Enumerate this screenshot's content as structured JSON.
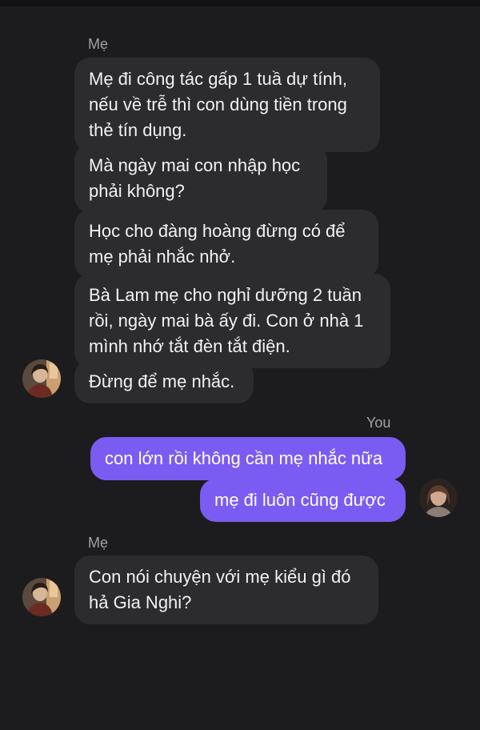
{
  "conversation": {
    "groups": [
      {
        "sender": "Mẹ",
        "messages": [
          "Mẹ đi công tác gấp 1 tuầ dự tính,\nnếu về trễ thì con dùng tiền trong\nthẻ tín dụng.",
          "Mà ngày mai con nhập học\nphải không?",
          "Học cho đàng hoàng đừng có để\nmẹ phải nhắc nhở.",
          "Bà Lam mẹ cho nghỉ dưỡng 2 tuần\nrồi, ngày mai bà ấy đi. Con ở nhà 1\nmình nhớ tắt đèn tắt điện.",
          "Đừng để mẹ nhắc."
        ],
        "avatar_icon": "mother-avatar-icon"
      },
      {
        "sender": "You",
        "messages": [
          "con lớn rồi không cần mẹ nhắc nữa",
          "mẹ đi luôn cũng được"
        ],
        "avatar_icon": "user-avatar-icon"
      },
      {
        "sender": "Mẹ",
        "messages": [
          "Con nói chuyện với mẹ kiểu gì đó\nhả Gia Nghi?"
        ],
        "avatar_icon": "mother-avatar-icon"
      }
    ]
  },
  "colors": {
    "background": "#1c1c1e",
    "incoming_bubble": "#2c2c2e",
    "outgoing_bubble": "#7a5cf2",
    "sender_label": "#a2a2a8"
  }
}
